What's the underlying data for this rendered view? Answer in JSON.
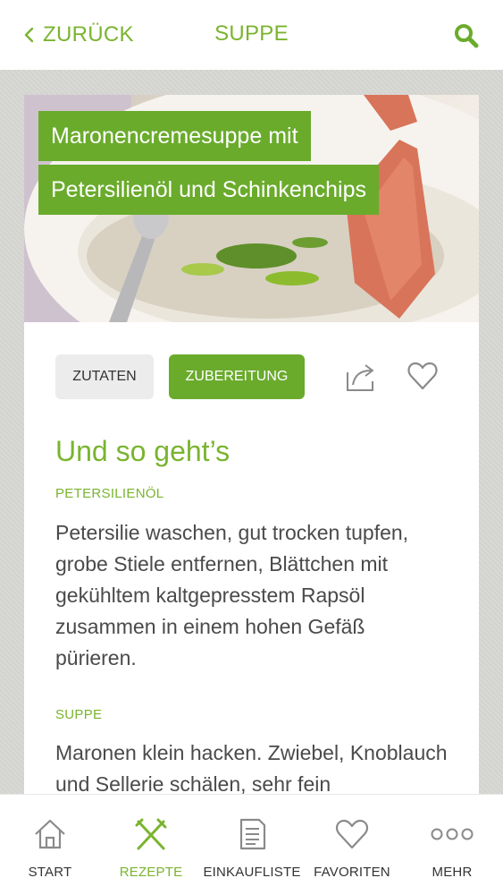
{
  "header": {
    "back_label": "ZURÜCK",
    "title": "SUPPE"
  },
  "recipe": {
    "title_line_1": "Maronencremesuppe mit",
    "title_line_2": "Petersilienöl und Schinkenchips"
  },
  "actions": {
    "ingredients_label": "ZUTATEN",
    "preparation_label": "ZUBEREITUNG",
    "active_tab": "ZUBEREITUNG"
  },
  "content": {
    "heading": "Und so geht’s",
    "steps": [
      {
        "label": "PETERSILIENÖL",
        "text": "Petersilie waschen, gut trocken tupfen, grobe Stiele entfernen, Blättchen mit gekühltem kaltgepresstem Rapsöl zusammen in einem hohen Gefäß pürieren."
      },
      {
        "label": "SUPPE",
        "text": "Maronen klein hacken. Zwiebel, Knoblauch und Sellerie schälen, sehr fein"
      }
    ]
  },
  "bottom_nav": {
    "items": [
      {
        "label": "START",
        "icon": "home-icon",
        "active": false
      },
      {
        "label": "REZEPTE",
        "icon": "fork-knife-icon",
        "active": true
      },
      {
        "label": "EINKAUFLISTE",
        "icon": "list-icon",
        "active": false
      },
      {
        "label": "FAVORITEN",
        "icon": "heart-icon",
        "active": false
      },
      {
        "label": "MEHR",
        "icon": "more-dots-icon",
        "active": false
      }
    ]
  },
  "colors": {
    "accent": "#7ab42f",
    "banner": "#6aab2c",
    "text": "#4a4a4a"
  }
}
